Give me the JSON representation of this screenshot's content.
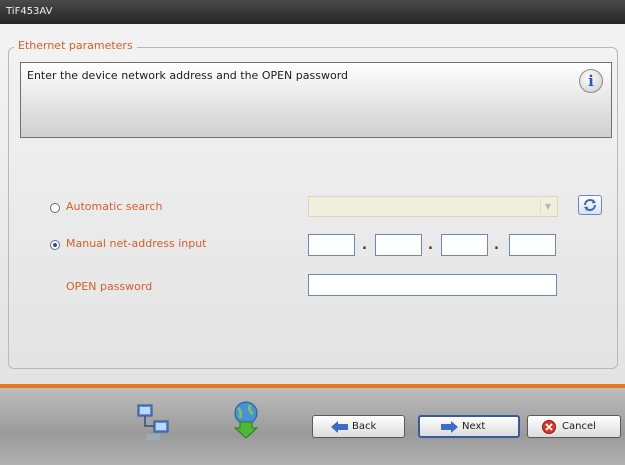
{
  "window": {
    "title": "TiF453AV"
  },
  "group": {
    "legend": "Ethernet parameters"
  },
  "info": {
    "text": "Enter the device network address and the OPEN password",
    "icon": "info-icon"
  },
  "options": {
    "automatic_search": {
      "label": "Automatic search",
      "selected": false
    },
    "manual_input": {
      "label": "Manual net-address input",
      "selected": true
    },
    "combo_value": "",
    "ip_address": [
      "",
      "",
      "",
      ""
    ],
    "ip_separators": [
      ".",
      ".",
      "."
    ],
    "password_label": "OPEN password",
    "password_value": ""
  },
  "footer": {
    "icons": [
      "network-devices-icon",
      "globe-download-icon"
    ],
    "back_label": "Back",
    "next_label": "Next",
    "cancel_label": "Cancel"
  },
  "colors": {
    "accent": "#e87722",
    "label": "#d0602a",
    "titlebar": "#333333"
  }
}
